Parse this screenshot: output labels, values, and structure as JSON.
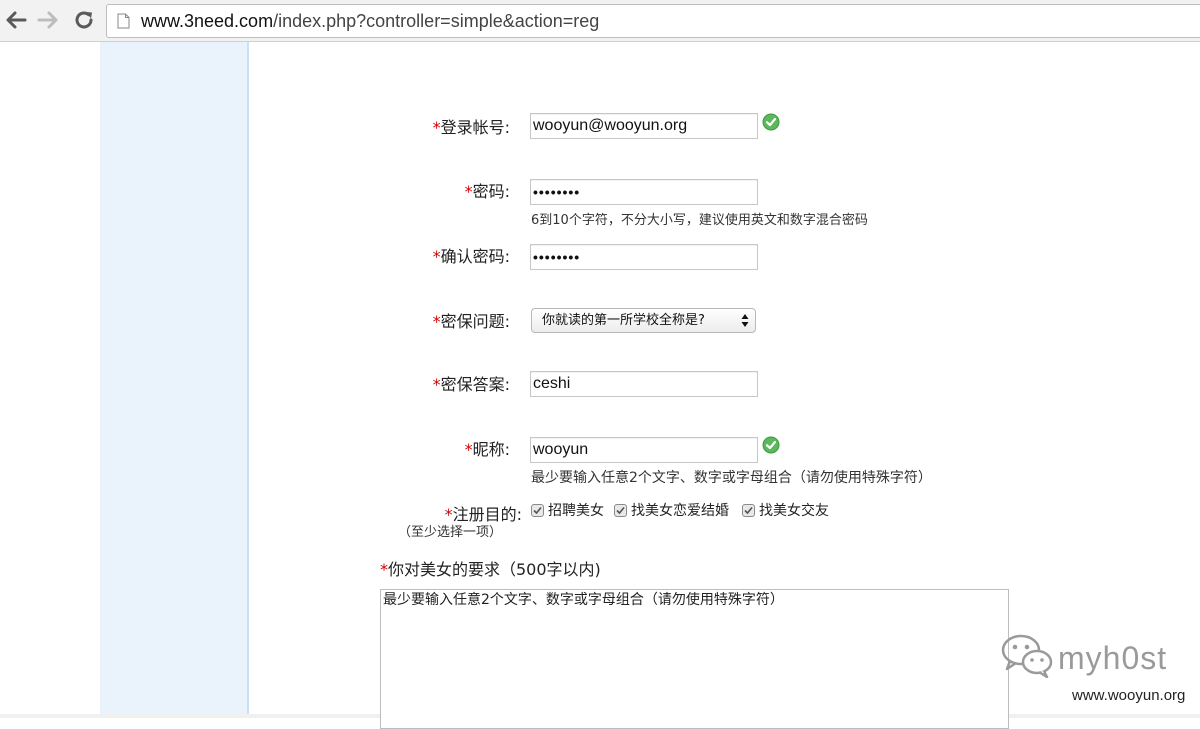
{
  "browser": {
    "url_host": "www.3need.com",
    "url_path": "/index.php?controller=simple&action=reg"
  },
  "form": {
    "required_mark": "*",
    "login": {
      "label": "登录帐号:",
      "value": "wooyun@wooyun.org"
    },
    "password": {
      "label": "密码:",
      "value": "••••••••",
      "hint": "6到10个字符，不分大小写，建议使用英文和数字混合密码"
    },
    "confirm_password": {
      "label": "确认密码:",
      "value": "••••••••"
    },
    "security_question": {
      "label": "密保问题:",
      "selected": "你就读的第一所学校全称是?"
    },
    "security_answer": {
      "label": "密保答案:",
      "value": "ceshi"
    },
    "nickname": {
      "label": "昵称:",
      "value": "wooyun",
      "hint": "最少要输入任意2个文字、数字或字母组合（请勿使用特殊字符）"
    },
    "purpose": {
      "label": "注册目的:",
      "sublabel": "（至少选择一项）",
      "options": [
        {
          "label": "招聘美女",
          "checked": true
        },
        {
          "label": "找美女恋爱结婚",
          "checked": true
        },
        {
          "label": "找美女交友",
          "checked": true
        }
      ]
    },
    "requirements": {
      "label": "你对美女的要求（500字以内)",
      "value": "最少要输入任意2个文字、数字或字母组合（请勿使用特殊字符）"
    }
  },
  "watermark": {
    "name": "myh0st",
    "site": "www.wooyun.org"
  },
  "colors": {
    "required": "#d40000",
    "check_ok": "#5cb85c",
    "strip": "#eaf3fb"
  }
}
